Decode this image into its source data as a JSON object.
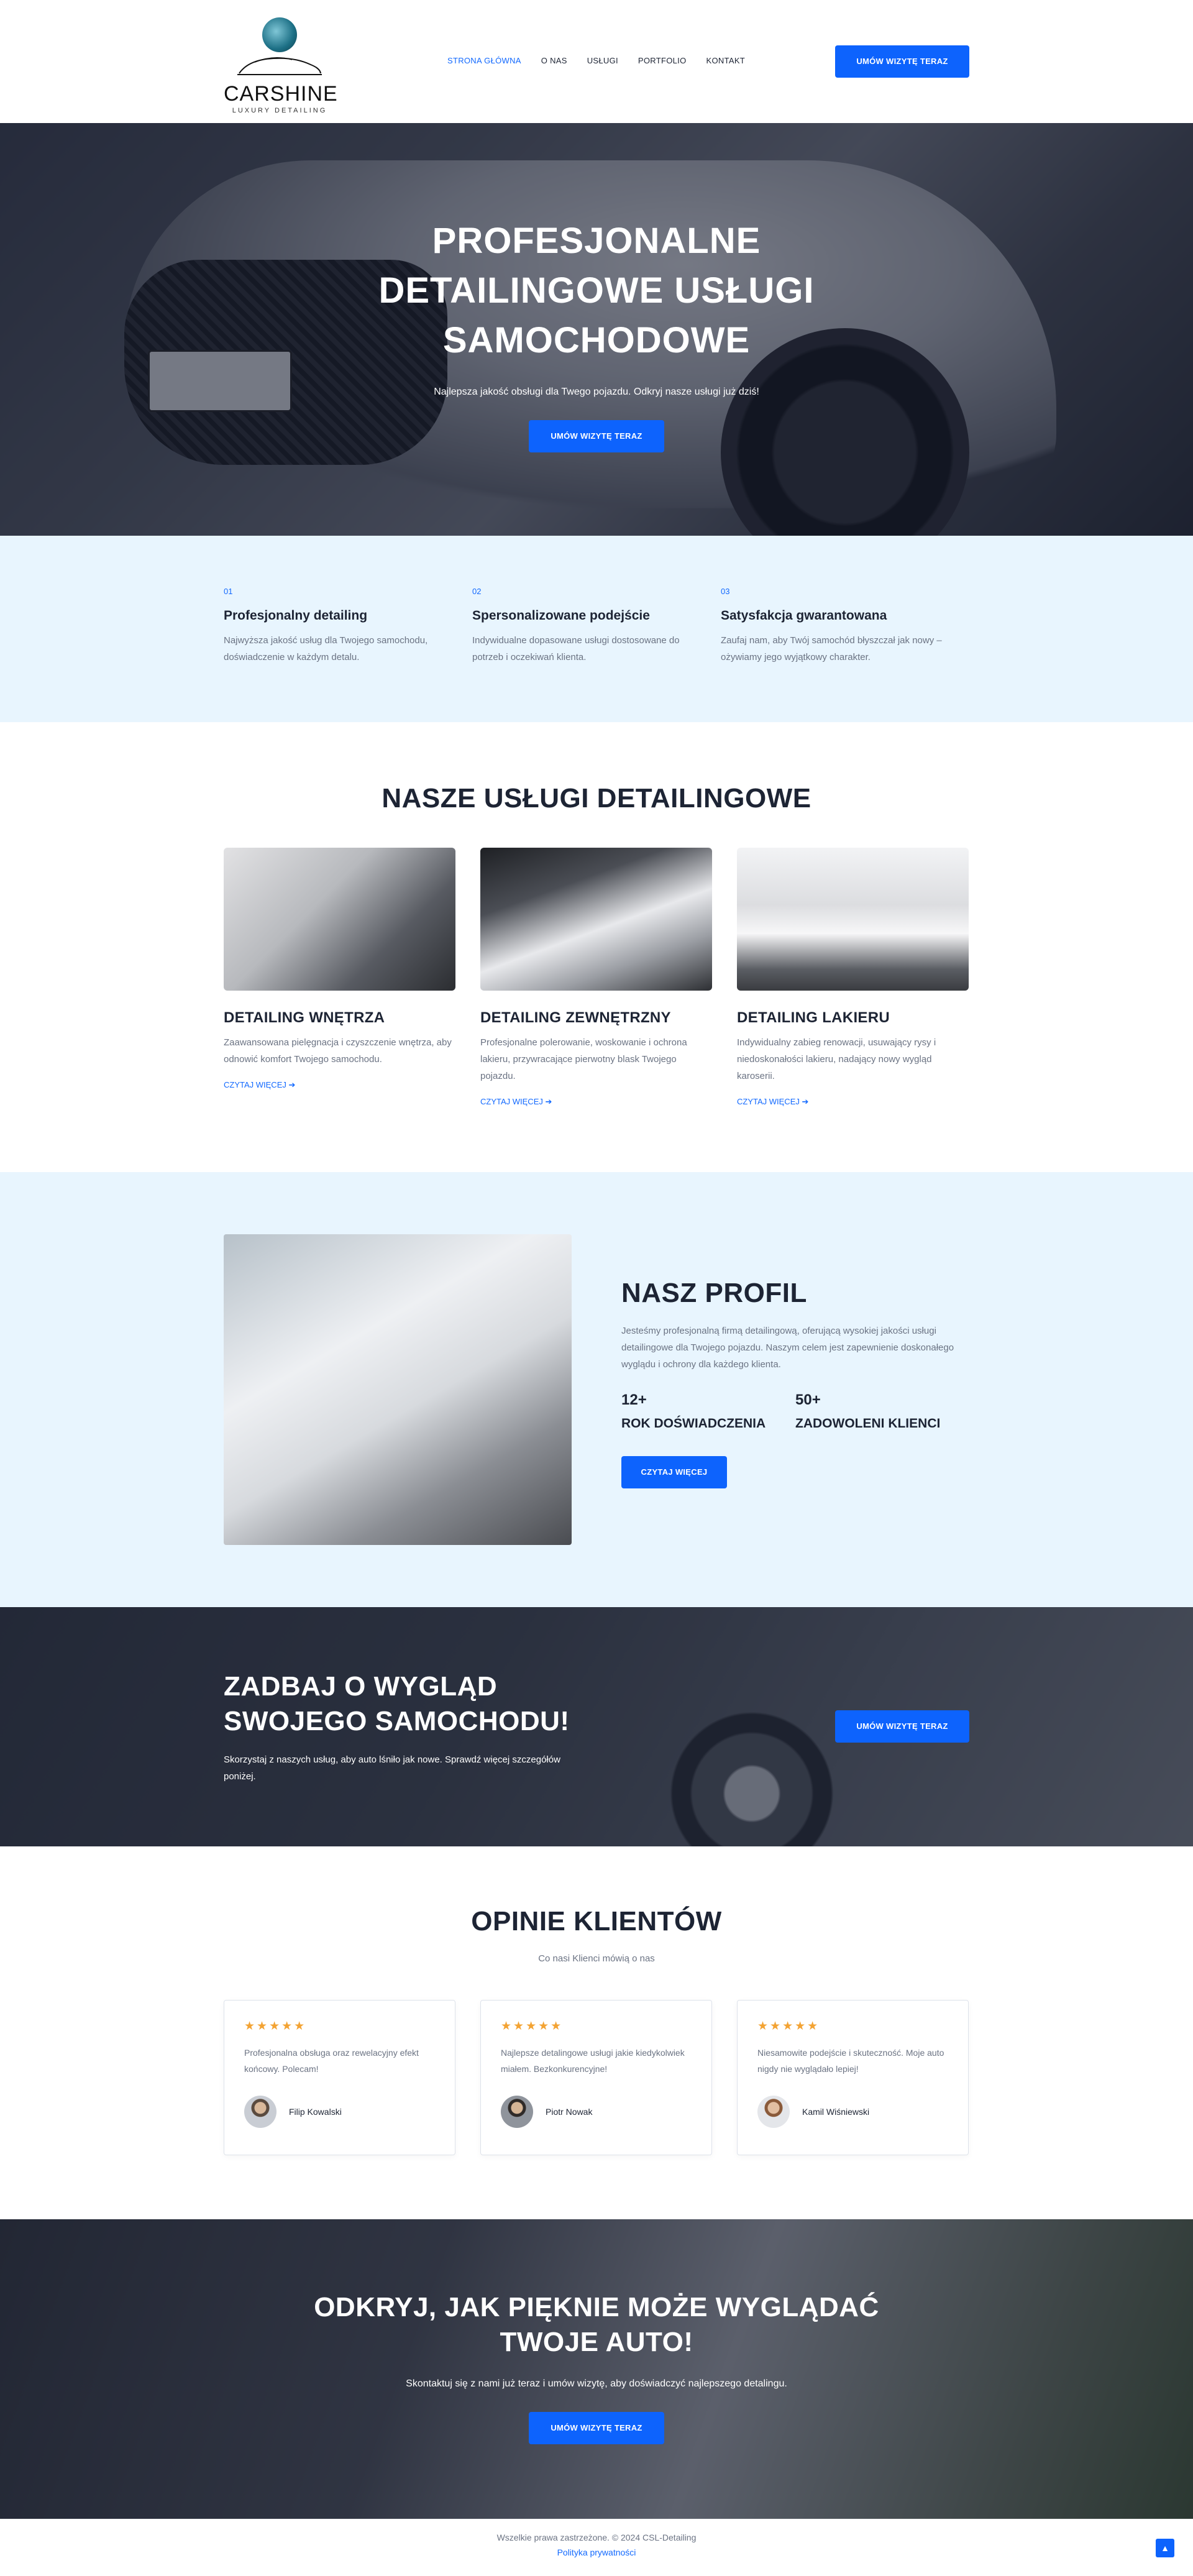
{
  "header": {
    "logo_name": "CARSHINE",
    "logo_sub": "LUXURY DETAILING",
    "nav": [
      "STRONA GŁÓWNA",
      "O NAS",
      "USŁUGI",
      "PORTFOLIO",
      "KONTAKT"
    ],
    "cta": "UMÓW WIZYTĘ TERAZ"
  },
  "hero": {
    "title_lines": [
      "PROFESJONALNE",
      "DETAILINGOWE USŁUGI",
      "SAMOCHODOWE"
    ],
    "subtitle": "Najlepsza jakość obsługi dla Twego pojazdu. Odkryj nasze usługi już dziś!",
    "cta": "UMÓW WIZYTĘ TERAZ"
  },
  "features": [
    {
      "num": "01",
      "title": "Profesjonalny detailing",
      "text": "Najwyższa jakość usług dla Twojego samochodu, doświadczenie w każdym detalu."
    },
    {
      "num": "02",
      "title": "Spersonalizowane podejście",
      "text": "Indywidualne dopasowane usługi dostosowane do potrzeb i oczekiwań klienta."
    },
    {
      "num": "03",
      "title": "Satysfakcja gwarantowana",
      "text": "Zaufaj nam, aby Twój samochód błyszczał jak nowy – ożywiamy jego wyjątkowy charakter."
    }
  ],
  "services": {
    "title": "NASZE USŁUGI DETAILINGOWE",
    "items": [
      {
        "title": "DETAILING WNĘTRZA",
        "text": "Zaawansowana pielęgnacja i czyszczenie wnętrza, aby odnowić komfort Twojego samochodu.",
        "more": "CZYTAJ WIĘCEJ"
      },
      {
        "title": "DETAILING ZEWNĘTRZNY",
        "text": "Profesjonalne polerowanie, woskowanie i ochrona lakieru, przywracające pierwotny blask Twojego pojazdu.",
        "more": "CZYTAJ WIĘCEJ"
      },
      {
        "title": "DETAILING LAKIERU",
        "text": "Indywidualny zabieg renowacji, usuwający rysy i niedoskonałości lakieru, nadający nowy wygląd karoserii.",
        "more": "CZYTAJ WIĘCEJ"
      }
    ]
  },
  "profile": {
    "title": "NASZ PROFIL",
    "text": "Jesteśmy profesjonalną firmą detailingową, oferującą wysokiej jakości usługi detailingowe dla Twojego pojazdu. Naszym celem jest zapewnienie doskonałego wyglądu i ochrony dla każdego klienta.",
    "stats": [
      {
        "value": "12+",
        "label": "ROK DOŚWIADCZENIA"
      },
      {
        "value": "50+",
        "label": "ZADOWOLENI KLIENCI"
      }
    ],
    "cta": "CZYTAJ WIĘCEJ"
  },
  "cta_band": {
    "title": "ZADBAJ O WYGLĄD SWOJEGO SAMOCHODU!",
    "text": "Skorzystaj z naszych usług, aby auto lśniło jak nowe. Sprawdź więcej szczegółów poniżej.",
    "cta": "UMÓW WIZYTĘ TERAZ"
  },
  "testimonials": {
    "title": "OPINIE KLIENTÓW",
    "subtitle": "Co nasi Klienci mówią o nas",
    "items": [
      {
        "stars": "★★★★★",
        "text": "Profesjonalna obsługa oraz rewelacyjny efekt końcowy. Polecam!",
        "author": "Filip Kowalski"
      },
      {
        "stars": "★★★★★",
        "text": "Najlepsze detalingowe usługi jakie kiedykolwiek miałem. Bezkonkurencyjne!",
        "author": "Piotr Nowak"
      },
      {
        "stars": "★★★★★",
        "text": "Niesamowite podejście i skuteczność. Moje auto nigdy nie wyglądało lepiej!",
        "author": "Kamil Wiśniewski"
      }
    ]
  },
  "final": {
    "title_lines": [
      "ODKRYJ, JAK PIĘKNIE MOŻE WYGLĄDAĆ",
      "TWOJE AUTO!"
    ],
    "text": "Skontaktuj się z nami już teraz i umów wizytę, aby doświadczyć najlepszego detalingu.",
    "cta": "UMÓW WIZYTĘ TERAZ"
  },
  "footer": {
    "copy": "Wszelkie prawa zastrzeżone. © 2024 CSL-Detailing",
    "policy": "Polityka prywatności"
  },
  "colors": {
    "accent": "#0d63fd",
    "light_bg": "#e8f5fe",
    "text": "#1d2434",
    "muted": "#6b7383",
    "star": "#f3a333"
  }
}
